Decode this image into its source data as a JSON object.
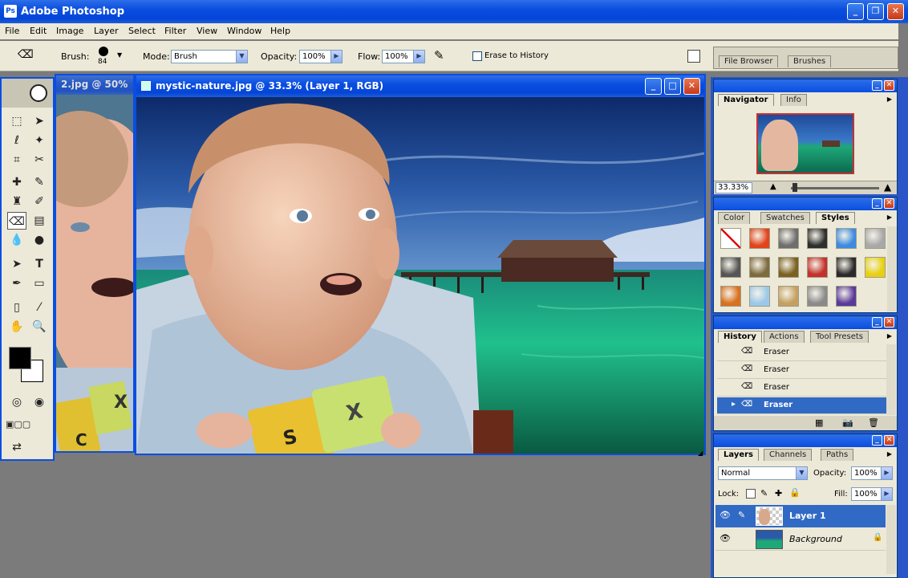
{
  "app": {
    "title": "Adobe Photoshop"
  },
  "menu": [
    "File",
    "Edit",
    "Image",
    "Layer",
    "Select",
    "Filter",
    "View",
    "Window",
    "Help"
  ],
  "options": {
    "brush_label": "Brush:",
    "brush_size": "84",
    "mode_label": "Mode:",
    "mode_value": "Brush",
    "opacity_label": "Opacity:",
    "opacity_value": "100%",
    "flow_label": "Flow:",
    "flow_value": "100%",
    "erase_to_history": "Erase to History",
    "well_tabs": [
      "File Browser",
      "Brushes"
    ]
  },
  "documents": {
    "background_title": "2.jpg @ 50%",
    "active_title": "mystic-nature.jpg @ 33.3% (Layer 1, RGB)",
    "block_letters": [
      "S",
      "X",
      "X",
      "C"
    ]
  },
  "navigator": {
    "tabs": [
      "Navigator",
      "Info"
    ],
    "zoom": "33.33%"
  },
  "styles_panel": {
    "tabs": [
      "Color",
      "Swatches",
      "Styles"
    ],
    "swatches": [
      "#ffffff",
      "#e2431a",
      "#6e6e6e",
      "#2e2e2e",
      "#3d8ae0",
      "#a8a8a8",
      "#555555",
      "#7d6a3e",
      "#7b6020",
      "#c4302b",
      "#2a2a2a",
      "#e8d010",
      "#d8701e",
      "#9bc8e8",
      "#c4a060",
      "#8a8a8a",
      "#5a3a9a"
    ]
  },
  "history": {
    "tabs": [
      "History",
      "Actions",
      "Tool Presets"
    ],
    "items": [
      "Eraser",
      "Eraser",
      "Eraser",
      "Eraser"
    ]
  },
  "layers_panel": {
    "tabs": [
      "Layers",
      "Channels",
      "Paths"
    ],
    "blend_mode": "Normal",
    "opacity_label": "Opacity:",
    "opacity_value": "100%",
    "lock_label": "Lock:",
    "fill_label": "Fill:",
    "fill_value": "100%",
    "layers": [
      "Layer 1",
      "Background"
    ]
  }
}
